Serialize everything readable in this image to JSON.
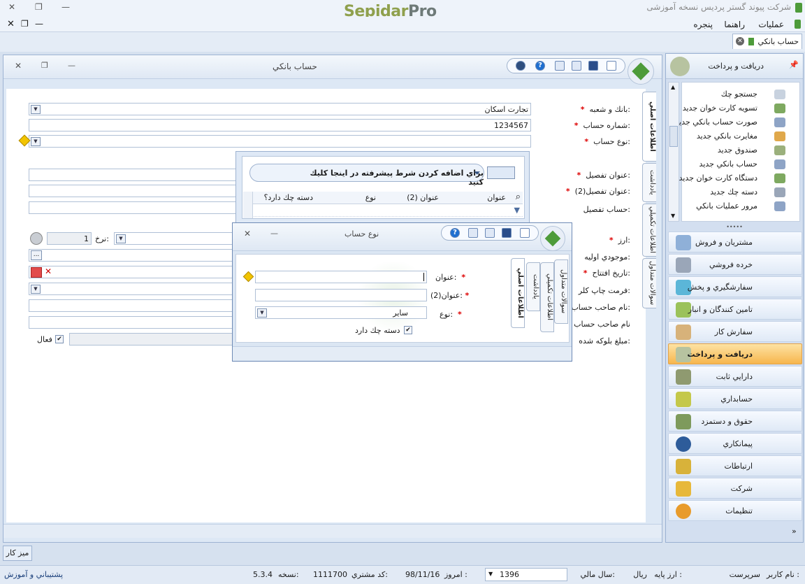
{
  "app": {
    "logo_left": "Sepidar",
    "logo_right": "Pro",
    "title": "شرکت پیوند گستر پردیس نسخه آموزشی"
  },
  "menu": [
    "عملیات",
    "راهنما",
    "پنجره"
  ],
  "doc_tab": "حساب بانکي",
  "form": {
    "title": "حساب بانکي",
    "tabs": [
      "اطلاعات اصلي",
      "يادداشت",
      "اطلاعات تكميلي",
      "سوالات متداول"
    ],
    "fields": {
      "bank_label": "بانك و شعبه:",
      "bank_value": "تجارت اسكان",
      "account_no_label": "شماره حساب:",
      "account_no_value": "1234567",
      "account_type_label": "نوع حساب:",
      "detail_title_label": "عنوان تفصيل:",
      "detail_title2_label": "عنوان تفصيل(2):",
      "detail_account_label": "حساب تفصيل:",
      "currency_label": "ارز:",
      "rate_label": "نرخ:",
      "rate_value": "1",
      "initial_balance_label": "موجودي اوليه:",
      "open_date_label": "تاريخ  افتتاح:",
      "check_print_label": "فرمت چاپ كلر:",
      "owner_name_label": "نام صاحب حساب:",
      "owner_name2_label": "نام صاحب حساب",
      "blocked_label": "مبلغ بلوكه شده:",
      "active_label": "فعال"
    }
  },
  "grid": {
    "filter_prompt": "براي اضافه كردن شرط پيشرفته در اينجا كليك كنيد",
    "columns": [
      "عنوان",
      "عنوان (2)",
      "نوع",
      "دسته چك دارد؟"
    ]
  },
  "dialog": {
    "title": "نوع حساب",
    "tabs": [
      "اطلاعات اصلي",
      "يادداشت",
      "اطلاعات تكميلي",
      "سوالات متداول"
    ],
    "title_label": "عنوان:",
    "title2_label": "عنوان(2):",
    "type_label": "نوع:",
    "type_value": "سایر",
    "has_checkbook_label": "دسته چك دارد"
  },
  "sidebar": {
    "header": "دریافت و پرداخت",
    "sub_items": [
      "جستجو چك",
      "تسويه كارت خوان جديد",
      "صورت حساب بانكي جديد",
      "مغايرت بانكي جديد",
      "صندوق جديد",
      "حساب بانكي جديد",
      "دستگاه كارت خوان جديد",
      "دسته چك جديد",
      "مرور عمليات بانكي"
    ],
    "nav": [
      "مشتريان و فروش",
      "خرده فروشي",
      "سفارشگيري و پخش",
      "تامين كنندگان و انبار",
      "سفارش كار",
      "دريافت و پرداخت",
      "دارايي ثابت",
      "حسابداري",
      "حقوق و دستمزد",
      "پيمانكاري",
      "ارتباطات",
      "شركت",
      "تنظيمات"
    ],
    "selected": "دريافت و پرداخت",
    "colors": {
      "selected": "#f7b64d"
    }
  },
  "bottom": {
    "desktop": "ميز كار",
    "user_label": "نام كاربر :",
    "user_value": "سرپرست",
    "base_currency_label": "ارز پايه :",
    "base_currency_value": "ريال",
    "fiscal_year_label": "سال مالي:",
    "fiscal_year_value": "1396",
    "today_label": "امروز :",
    "today_value": "98/11/16",
    "customer_code_label": "كد مشتري:",
    "customer_code_value": "1111700",
    "version_label": "نسخه:",
    "version_value": "5.3.4",
    "support": "پشتيباني و آموزش"
  }
}
